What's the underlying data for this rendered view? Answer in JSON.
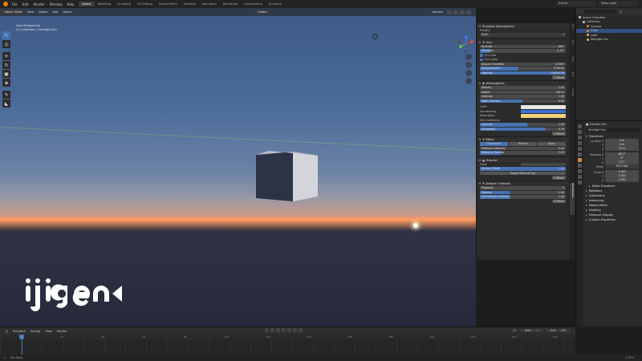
{
  "app": {
    "menu": [
      "File",
      "Edit",
      "Render",
      "Window",
      "Help"
    ],
    "workspaces": [
      "Layout",
      "Modeling",
      "Sculpting",
      "UV Editing",
      "Texture Paint",
      "Shading",
      "Animation",
      "Rendering",
      "Compositing",
      "Scripting"
    ],
    "active_workspace": "Layout",
    "scene_field": "Scene",
    "view_layer_field": "View Layer"
  },
  "viewport": {
    "mode": "Object Mode",
    "menus": [
      "View",
      "Select",
      "Add",
      "Object"
    ],
    "transform_orientation": "Global",
    "options_label": "Options",
    "info_line1": "User Perspective",
    "info_line2": "(1) Collection | Starlight Sun",
    "gizmo_axes": [
      "X",
      "Y",
      "Z"
    ]
  },
  "npanel": {
    "title": "Physical Atmosphere",
    "presets_label": "Presets",
    "presets_value": "Earth",
    "sun": {
      "title": "Sun",
      "azimuth_label": "Azimuth",
      "azimuth_value": "180°",
      "elevation_label": "Elevation",
      "elevation_value": "2.70°",
      "sun_disk_label": "Sun Disk",
      "sun_lamp_label": "Sun Lamp",
      "angular_diameter_label": "Angular Diameter",
      "angular_diameter_value": "0.526°",
      "temperature_label": "Temperature K",
      "temperature_value": "5700.00",
      "intensity_label": "Intensity",
      "intensity_value": "200000.00",
      "reset_label": "Reset"
    },
    "atmosphere": {
      "title": "Atmosphere",
      "density_label": "Density",
      "density_value": "1.00",
      "height_label": "Height",
      "height_value": "300 m",
      "intensity_label": "Intensity",
      "intensity_value": "1.00",
      "night_intensity_label": "Night Intensity",
      "night_intensity_value": "0.80",
      "color_label": "Color",
      "inscattering_label": "Inscattering",
      "absorption_label": "Absorption",
      "mie_label": "Mie Scattering",
      "mie_intensity_label": "Intensity",
      "mie_intensity_value": "1.00",
      "anisotropy_label": "Anisotropy",
      "anisotropy_value": "0.76",
      "color_swatch": "#e6e6e6",
      "inscattering_swatch": "#3a6fd6",
      "absorption_swatch": "#f0d27a",
      "reset_label": "Reset"
    },
    "stars": {
      "title": "Stars",
      "tabs": [
        "Procedural",
        "Texture",
        "None"
      ],
      "radiance_intensity_label": "Radiance Intensity",
      "radiance_intensity_value": "0.20",
      "radiance_gamma_label": "Radiance Gamma",
      "radiance_gamma_value": "2.20"
    },
    "ground": {
      "title": "Ground",
      "color_label": "Color",
      "color_swatch": "#474747",
      "horizon_offset_label": "Horizon Offset",
      "horizon_offset_value": "1.00",
      "toggle_fog_label": "Toggle Material Fog",
      "reset_label": "Reset"
    },
    "artistic": {
      "title": "Artistic Controls",
      "exposure_label": "Exposure",
      "exposure_value": "0",
      "gamma_label": "Gamma",
      "gamma_value": "1.00",
      "disk_radiance_label": "Sun Radiance Gamma",
      "disk_radiance_value": "1.00",
      "reset_label": "Reset"
    },
    "side_tabs": [
      "Item",
      "Tool",
      "View",
      "Edit",
      "Create",
      "Atmosphere"
    ],
    "active_side_tab": "Atmosphere"
  },
  "outliner": {
    "search_placeholder": "",
    "rows": [
      {
        "label": "Scene Collection",
        "indent": 0,
        "color": "#cfcfcf"
      },
      {
        "label": "Collection",
        "indent": 1,
        "color": "#cfcfcf"
      },
      {
        "label": "Camera",
        "indent": 2,
        "color": "#d9883a"
      },
      {
        "label": "Cube",
        "indent": 2,
        "color": "#d9883a"
      },
      {
        "label": "Light",
        "indent": 2,
        "color": "#e8c04a"
      },
      {
        "label": "Starlight Sun",
        "indent": 2,
        "color": "#e8c04a"
      }
    ],
    "selected_index": 3
  },
  "properties": {
    "object_name_header": "Starlight Sun",
    "object_name_field": "Starlight Sun",
    "transform_title": "Transform",
    "location_label": "Location X",
    "location": [
      "0 m",
      "0 m",
      "22 m"
    ],
    "rotation_label": "Rotation X",
    "rotation": [
      "86.3°",
      "0°",
      "277°"
    ],
    "mode_label": "Mode",
    "mode_value": "XYZ Euler",
    "scale_label": "Scale X",
    "scale": [
      "1.000",
      "1.000",
      "1.000"
    ],
    "axis_y": "Y",
    "axis_z": "Z",
    "sections": [
      "Delta Transform",
      "Relations",
      "Collections",
      "Instancing",
      "Motion Paths",
      "Visibility",
      "Viewport Display",
      "Custom Properties"
    ]
  },
  "timeline": {
    "menus": [
      "Playback",
      "Keying",
      "View",
      "Marker"
    ],
    "current_frame": "1",
    "start_label": "Start",
    "start_value": "1",
    "end_label": "End",
    "end_value": "250",
    "ruler": [
      "1",
      "20",
      "40",
      "60",
      "80",
      "100",
      "120",
      "140",
      "160",
      "180",
      "200",
      "220",
      "240",
      "250"
    ],
    "cursor_frame": "1"
  },
  "status": {
    "hint": "Pan View",
    "version": "2.93.0"
  }
}
